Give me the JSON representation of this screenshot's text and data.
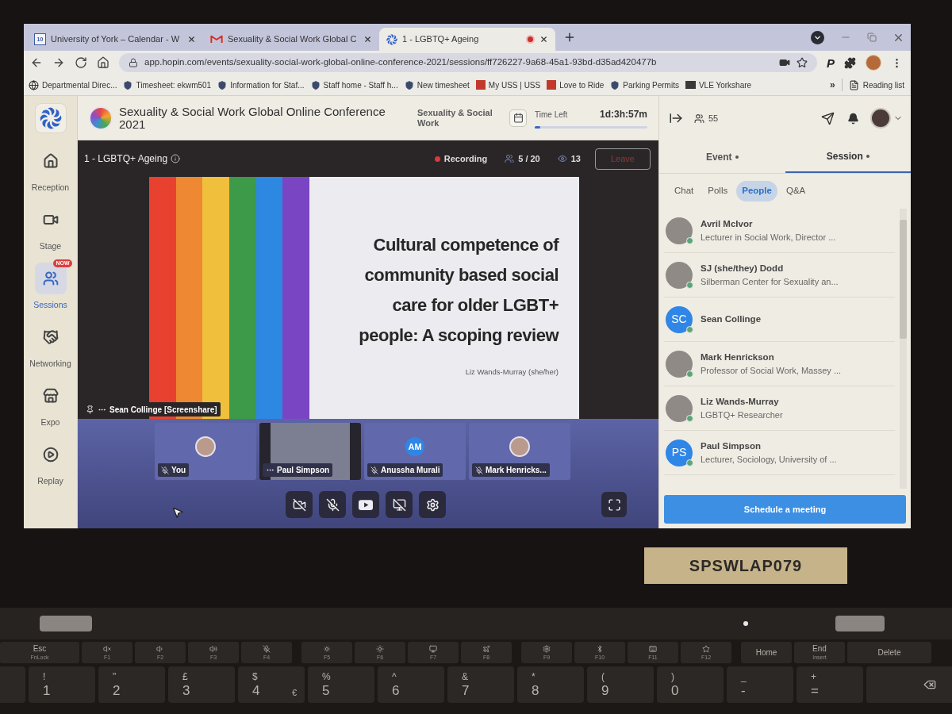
{
  "browser": {
    "tabs": [
      {
        "title": "University of York – Calendar - W",
        "favicon_label": "10",
        "selected": false,
        "recording": false
      },
      {
        "title": "Sexuality & Social Work Global C",
        "selected": false,
        "recording": false
      },
      {
        "title": "1 - LGBTQ+ Ageing",
        "selected": true,
        "recording": true
      }
    ],
    "url": "app.hopin.com/events/sexuality-social-work-global-online-conference-2021/sessions/ff726227-9a68-45a1-93bd-d35ad420477b",
    "extension_label": "P",
    "bookmarks": [
      "Departmental Direc...",
      "Timesheet: ekwm501",
      "Information for Staf...",
      "Staff home - Staff h...",
      "New timesheet",
      "My USS | USS",
      "Love to Ride",
      "Parking Permits",
      "VLE Yorkshare"
    ],
    "more_bookmarks": "»",
    "reading_list": "Reading list"
  },
  "sidebar": {
    "items": [
      {
        "label": "Reception",
        "selected": false
      },
      {
        "label": "Stage",
        "selected": false
      },
      {
        "label": "Sessions",
        "selected": true,
        "badge": "NOW"
      },
      {
        "label": "Networking",
        "selected": false
      },
      {
        "label": "Expo",
        "selected": false
      },
      {
        "label": "Replay",
        "selected": false
      }
    ]
  },
  "header": {
    "event_title": "Sexuality & Social Work Global Online Conference 2021",
    "organizer": "Sexuality & Social Work",
    "time_left_label": "Time Left",
    "time_left": "1d:3h:57m",
    "level": 0.05
  },
  "stage": {
    "title": "1 - LGBTQ+ Ageing",
    "recording": true,
    "recording_label": "Recording",
    "capacity": "5 / 20",
    "viewers": "13",
    "leave_label": "Leave",
    "slide": {
      "title_lines": [
        "Cultural competence of",
        "community based social",
        "care for older LGBT+",
        "people: A scoping review"
      ],
      "author": "Liz Wands-Murray (she/her)"
    },
    "presenter": "Sean Collinge [Screenshare]",
    "participants": [
      {
        "name": "You",
        "kind": "photo",
        "muted": true,
        "hovered": false
      },
      {
        "name": "Paul Simpson",
        "kind": "video",
        "muted": false,
        "hovered": true
      },
      {
        "name": "Anussha Murali",
        "kind": "initials",
        "initials": "AM",
        "muted": true,
        "hovered": false
      },
      {
        "name": "Mark Henricks...",
        "kind": "photo",
        "muted": true,
        "hovered": false
      }
    ],
    "controls": {
      "camera_on": false,
      "mic_on": false,
      "screen_sharing": false
    }
  },
  "panel": {
    "attendee_count": "55",
    "tabs": [
      {
        "label": "Event",
        "selected": false,
        "unread": true
      },
      {
        "label": "Session",
        "selected": true,
        "unread": true
      }
    ],
    "subtabs": [
      {
        "label": "Chat",
        "selected": false
      },
      {
        "label": "Polls",
        "selected": false
      },
      {
        "label": "People",
        "selected": true
      },
      {
        "label": "Q&A",
        "selected": false
      }
    ],
    "people": [
      {
        "name": "Avril McIvor",
        "subtitle": "Lecturer in Social Work, Director ...",
        "kind": "photo"
      },
      {
        "name": "SJ (she/they) Dodd",
        "subtitle": "Silberman Center for Sexuality an...",
        "kind": "photo"
      },
      {
        "name": "Sean Collinge",
        "kind": "initials",
        "initials": "SC"
      },
      {
        "name": "Mark Henrickson",
        "subtitle": "Professor of Social Work, Massey ...",
        "kind": "photo"
      },
      {
        "name": "Liz Wands-Murray",
        "subtitle": "LGBTQ+ Researcher",
        "kind": "photo"
      },
      {
        "name": "Paul Simpson",
        "subtitle": "Lecturer, Sociology, University of ...",
        "kind": "initials",
        "initials": "PS"
      }
    ],
    "schedule_label": "Schedule a meeting"
  },
  "laptop": {
    "asset_tag": "SPSWLAP079",
    "function_keys": [
      {
        "kind": "text",
        "label": "Esc",
        "sub": "FnLock"
      },
      {
        "kind": "icon",
        "sub": "F1"
      },
      {
        "kind": "icon",
        "sub": "F2"
      },
      {
        "kind": "icon",
        "sub": "F3"
      },
      {
        "kind": "icon",
        "sub": "F4"
      },
      {
        "kind": "icon",
        "sub": "F5"
      },
      {
        "kind": "icon",
        "sub": "F6"
      },
      {
        "kind": "icon",
        "sub": "F7"
      },
      {
        "kind": "icon",
        "sub": "F8"
      },
      {
        "kind": "icon",
        "sub": "F9"
      },
      {
        "kind": "icon",
        "sub": "F10"
      },
      {
        "kind": "icon",
        "sub": "F11"
      },
      {
        "kind": "icon",
        "sub": "F12"
      },
      {
        "kind": "text",
        "label": "Home"
      },
      {
        "kind": "text",
        "label": "End",
        "sub": "Insert"
      },
      {
        "kind": "text",
        "label": "Delete"
      }
    ],
    "number_keys": [
      {
        "shift": "!",
        "main": "1"
      },
      {
        "shift": "\"",
        "main": "2"
      },
      {
        "shift": "£",
        "main": "3"
      },
      {
        "shift": "$",
        "main": "4",
        "alt": "€"
      },
      {
        "shift": "%",
        "main": "5"
      },
      {
        "shift": "^",
        "main": "6"
      },
      {
        "shift": "&",
        "main": "7"
      },
      {
        "shift": "*",
        "main": "8"
      },
      {
        "shift": "(",
        "main": "9"
      },
      {
        "shift": ")",
        "main": "0"
      },
      {
        "shift": "_",
        "main": "-"
      },
      {
        "shift": "+",
        "main": "="
      }
    ]
  }
}
